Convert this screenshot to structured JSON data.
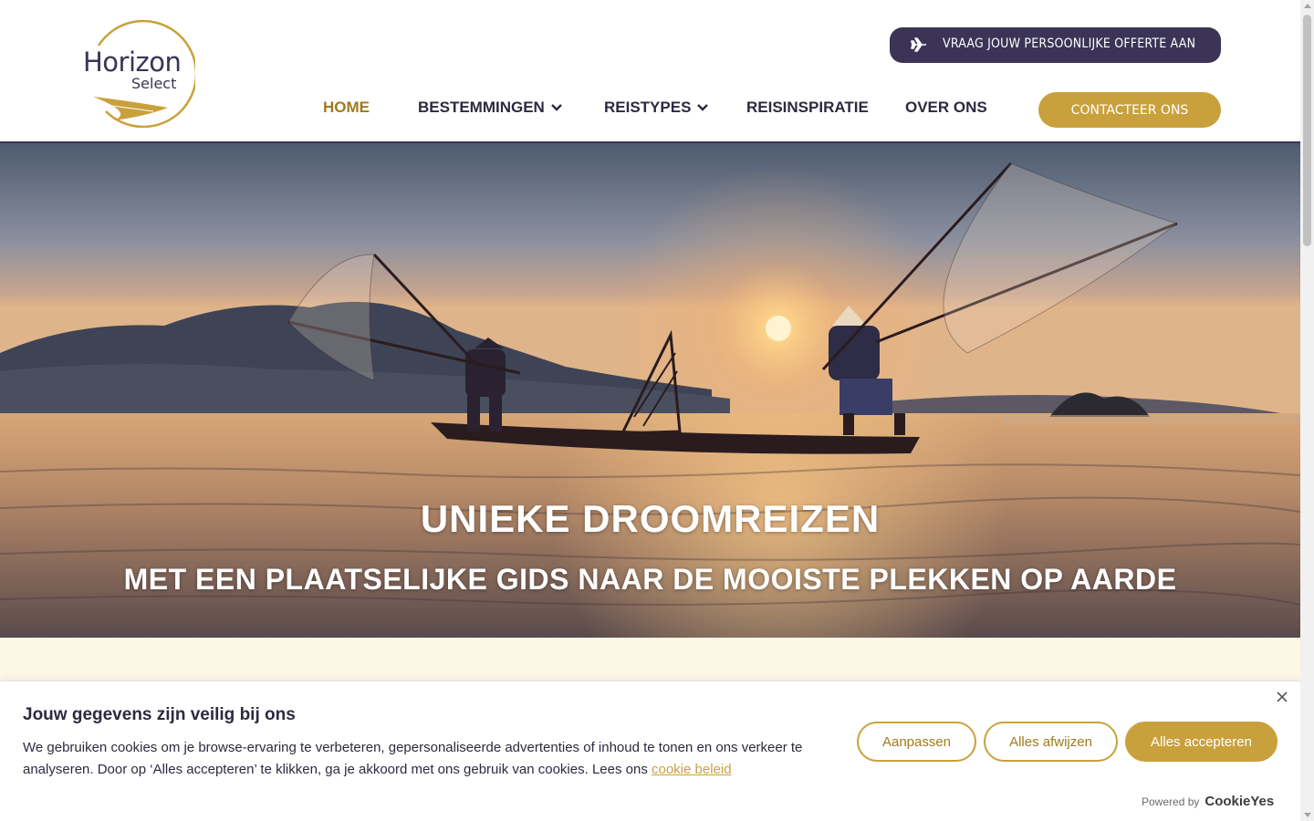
{
  "brand": {
    "name_line1": "Horizon",
    "name_line2": "Select",
    "gold": "#c9a13c",
    "purple": "#3b3456"
  },
  "header": {
    "offer_button": {
      "label": "VRAAG JOUW PERSOONLIJKE OFFERTE AAN",
      "icon": "plane-icon"
    },
    "contact_button": {
      "label": "CONTACTEER ONS"
    },
    "nav": [
      {
        "label": "HOME",
        "active": true
      },
      {
        "label": "BESTEMMINGEN",
        "dropdown": true
      },
      {
        "label": "REISTYPES",
        "dropdown": true
      },
      {
        "label": "REISINSPIRATIE"
      },
      {
        "label": "OVER ONS"
      }
    ]
  },
  "hero": {
    "title": "UNIEKE DROOMREIZEN",
    "subtitle": "MET EEN PLAATSELIJKE GIDS NAAR DE MOOISTE PLEKKEN OP AARDE"
  },
  "cookie": {
    "title": "Jouw gegevens zijn veilig bij ons",
    "text": "We gebruiken cookies om je browse-ervaring te verbeteren, gepersonaliseerde advertenties of inhoud te tonen en ons verkeer te analyseren. Door op ‘Alles accepteren’ te klikken, ga je akkoord met ons gebruik van cookies. Lees ons",
    "link": "cookie beleid",
    "customize": "Aanpassen",
    "reject": "Alles afwijzen",
    "accept": "Alles accepteren",
    "powered_by": "Powered by",
    "provider": "CookieYes"
  }
}
